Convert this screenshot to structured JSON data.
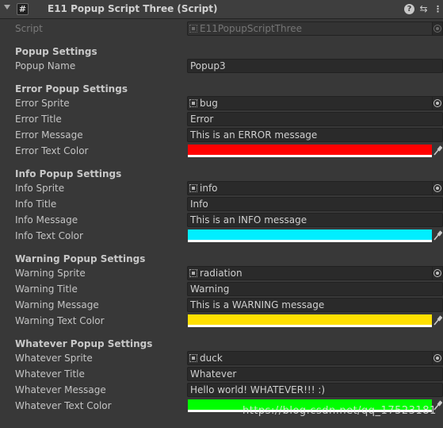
{
  "header": {
    "title": "E11 Popup Script Three (Script)"
  },
  "script_row": {
    "label": "Script",
    "value": "E11PopupScriptThree"
  },
  "popup_settings": {
    "header": "Popup Settings",
    "name_label": "Popup Name",
    "name_value": "Popup3"
  },
  "error": {
    "header": "Error Popup Settings",
    "sprite_label": "Error Sprite",
    "sprite_value": "bug",
    "title_label": "Error Title",
    "title_value": "Error",
    "message_label": "Error Message",
    "message_value": "This is an ERROR message",
    "color_label": "Error Text Color",
    "color": "#ff0000"
  },
  "info": {
    "header": "Info Popup Settings",
    "sprite_label": "Info Sprite",
    "sprite_value": "info",
    "title_label": "Info Title",
    "title_value": "Info",
    "message_label": "Info Message",
    "message_value": "This is an INFO message",
    "color_label": "Info Text Color",
    "color": "#00eeff"
  },
  "warning": {
    "header": "Warning Popup Settings",
    "sprite_label": "Warning Sprite",
    "sprite_value": "radiation",
    "title_label": "Warning Title",
    "title_value": "Warning",
    "message_label": "Warning Message",
    "message_value": "This is a WARNING message",
    "color_label": "Warning Text Color",
    "color": "#ffe000"
  },
  "whatever": {
    "header": "Whatever Popup Settings",
    "sprite_label": "Whatever Sprite",
    "sprite_value": "duck",
    "title_label": "Whatever Title",
    "title_value": "Whatever",
    "message_label": "Whatever Message",
    "message_value": "Hello world! WHATEVER!!! :)",
    "color_label": "Whatever Text Color",
    "color": "#00ff00"
  },
  "watermark": "https://blog.csdn.net/qq_17523181"
}
